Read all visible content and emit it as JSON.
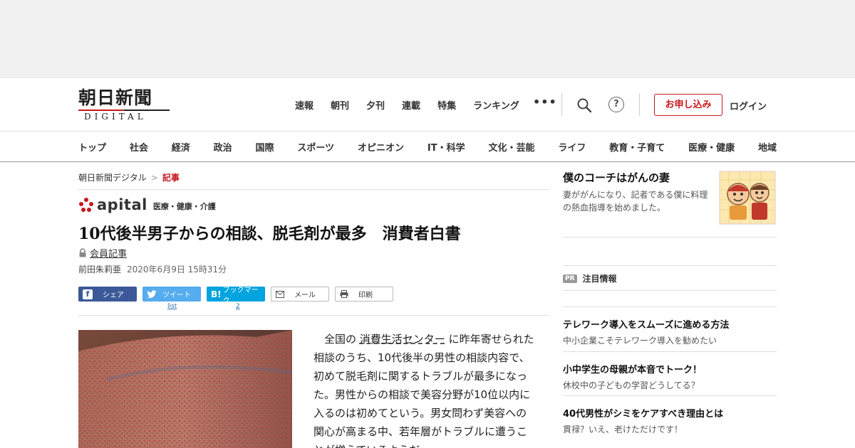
{
  "header": {
    "logo_text": "朝日新聞",
    "logo_sub": "DIGITAL",
    "top_nav": [
      "速報",
      "朝刊",
      "夕刊",
      "連載",
      "特集",
      "ランキング"
    ],
    "more_label": "•••",
    "help_label": "?",
    "apply_label": "お申し込み",
    "login_label": "ログイン"
  },
  "categories": [
    "トップ",
    "社会",
    "経済",
    "政治",
    "国際",
    "スポーツ",
    "オピニオン",
    "IT・科学",
    "文化・芸能",
    "ライフ",
    "教育・子育て",
    "医療・健康",
    "地域"
  ],
  "breadcrumb": {
    "home": "朝日新聞デジタル",
    "sep": ">",
    "current": "記事"
  },
  "section": {
    "logo_word": "apital",
    "category": "医療・健康・介護"
  },
  "article": {
    "title": "10代後半男子からの相談、脱毛剤が最多　消費者白書",
    "member_label": "会員記事",
    "author": "前田朱莉亜",
    "date": "2020年6月9日 15時31分",
    "body_before_link": "　全国の ",
    "body_link": "消費生活センター",
    "body_after_link": " に昨年寄せられた相談のうち、10代後半の男性の相談内容で、初めて脱毛剤に関するトラブルが最多になった。男性からの相談で美容分野が10位以内に入るのは初めてという。男女問わず美容への関心が高まる中、若年層がトラブルに遭うことが増えているようだ。"
  },
  "share": {
    "facebook": "シェア",
    "twitter": "ツイート",
    "hatena": "ブックマーク",
    "mail": "メール",
    "print": "印刷",
    "twitter_count": "list",
    "hatena_count": "2"
  },
  "sidebar": {
    "promo_title": "僕のコーチはがんの妻",
    "promo_desc": "妻ががんになり、記者である僕に料理の熱血指導を始めました。",
    "pr_badge": "PR",
    "pr_title": "注目情報",
    "pr_items": [
      {
        "title": "テレワーク導入をスムーズに進める方法",
        "desc": "中小企業こそテレワーク導入を勧めたい"
      },
      {
        "title": "小中学生の母親が本音でトーク！",
        "desc": "休校中の子どもの学習どうしてる？"
      },
      {
        "title": "40代男性がシミをケアすべき理由とは",
        "desc": "貫禄？いえ、老けただけです！"
      }
    ]
  },
  "colors": {
    "brand_red": "#c8161d",
    "facebook": "#3b5998",
    "twitter": "#55acee",
    "hatena": "#00a4de"
  }
}
